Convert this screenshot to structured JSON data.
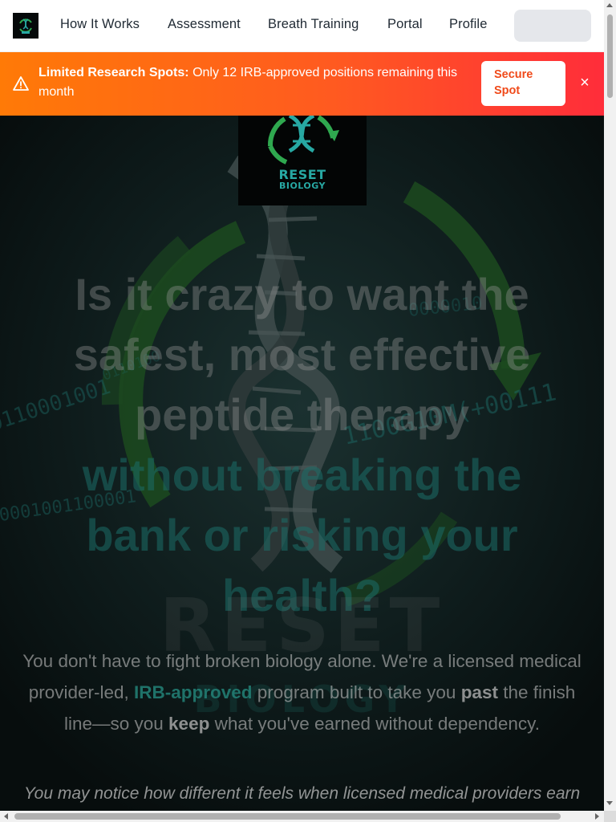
{
  "nav": {
    "logo_icon": "reset-biology-logo",
    "links": [
      "How It Works",
      "Assessment",
      "Breath Training",
      "Portal",
      "Profile"
    ]
  },
  "banner": {
    "title": "Limited Research Spots:",
    "message": "Only 12 IRB-approved positions remaining this month",
    "button_line1": "Secure",
    "button_line2": "Spot",
    "close": "×",
    "icon": "warning-triangle-icon",
    "colors": {
      "start": "#ff7a07",
      "end": "#ff2d3a"
    }
  },
  "hero": {
    "logo_line1": "RESET",
    "logo_line2": "BIOLOGY",
    "headline_l1": "Is it crazy to want the",
    "headline_l2": "safest, most effective",
    "headline_l3": "peptide therapy",
    "headline_l4": "without breaking the",
    "headline_l5": "bank or risking your",
    "headline_l6": "health?",
    "watermark_1": "RESET",
    "watermark_2": "BIOLOGY",
    "sub_a": "You don't have to fight broken biology alone. We're a licensed medical provider-led, ",
    "sub_hl": "IRB-approved",
    "sub_b": " program built to take you ",
    "sub_past": "past",
    "sub_c": " the finish line—so you ",
    "sub_keep": "keep",
    "sub_d": " what you've earned without dependency.",
    "italic": "You may notice how different it feels when licensed medical providers earn",
    "colors": {
      "teal": "#1c6e68",
      "background": "#0a1313"
    }
  }
}
